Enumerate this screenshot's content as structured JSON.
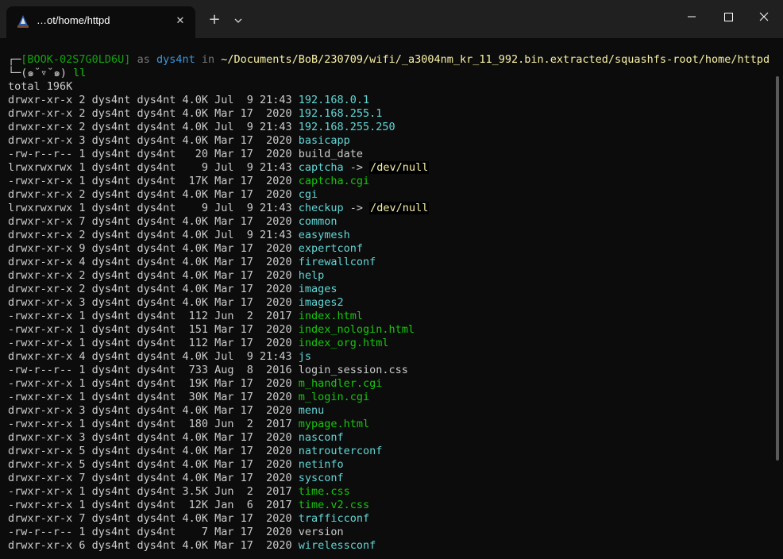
{
  "window": {
    "tab_title": "…ot/home/httpd",
    "close_tab_glyph": "✕",
    "new_tab_glyph": "+",
    "icons": [
      "terminal-app-icon",
      "close-icon",
      "plus-icon",
      "chevron-down-icon",
      "minimize-icon",
      "maximize-icon",
      "window-close-icon"
    ]
  },
  "prompt": {
    "line1_prefix": "┌─",
    "host": "[BOOK-02S7G0LD6U]",
    "as": " as ",
    "user": "dys4nt",
    "in": " in ",
    "path": "~/Documents/BoB/230709/wifi/_a3004nm_kr_11_992.bin.extracted/squashfs-root/home/httpd",
    "line2_prefix": "└─",
    "face": "(๑˘▿˘๑)",
    "command": " ll"
  },
  "total": "total 196K",
  "entries": [
    {
      "meta": "drwxr-xr-x 2 dys4nt dys4nt 4.0K Jul  9 21:43 ",
      "name": "192.168.0.1",
      "kind": "dir"
    },
    {
      "meta": "drwxr-xr-x 2 dys4nt dys4nt 4.0K Mar 17  2020 ",
      "name": "192.168.255.1",
      "kind": "dir"
    },
    {
      "meta": "drwxr-xr-x 2 dys4nt dys4nt 4.0K Jul  9 21:43 ",
      "name": "192.168.255.250",
      "kind": "dir"
    },
    {
      "meta": "drwxr-xr-x 3 dys4nt dys4nt 4.0K Mar 17  2020 ",
      "name": "basicapp",
      "kind": "dir"
    },
    {
      "meta": "-rw-r--r-- 1 dys4nt dys4nt   20 Mar 17  2020 ",
      "name": "build_date",
      "kind": "plain"
    },
    {
      "meta": "lrwxrwxrwx 1 dys4nt dys4nt    9 Jul  9 21:43 ",
      "name": "captcha",
      "kind": "link",
      "arrow": " -> ",
      "target": "/dev/null"
    },
    {
      "meta": "-rwxr-xr-x 1 dys4nt dys4nt  17K Mar 17  2020 ",
      "name": "captcha.cgi",
      "kind": "exe"
    },
    {
      "meta": "drwxr-xr-x 2 dys4nt dys4nt 4.0K Mar 17  2020 ",
      "name": "cgi",
      "kind": "dir"
    },
    {
      "meta": "lrwxrwxrwx 1 dys4nt dys4nt    9 Jul  9 21:43 ",
      "name": "checkup",
      "kind": "link",
      "arrow": " -> ",
      "target": "/dev/null"
    },
    {
      "meta": "drwxr-xr-x 7 dys4nt dys4nt 4.0K Mar 17  2020 ",
      "name": "common",
      "kind": "dir"
    },
    {
      "meta": "drwxr-xr-x 2 dys4nt dys4nt 4.0K Jul  9 21:43 ",
      "name": "easymesh",
      "kind": "dir"
    },
    {
      "meta": "drwxr-xr-x 9 dys4nt dys4nt 4.0K Mar 17  2020 ",
      "name": "expertconf",
      "kind": "dir"
    },
    {
      "meta": "drwxr-xr-x 4 dys4nt dys4nt 4.0K Mar 17  2020 ",
      "name": "firewallconf",
      "kind": "dir"
    },
    {
      "meta": "drwxr-xr-x 2 dys4nt dys4nt 4.0K Mar 17  2020 ",
      "name": "help",
      "kind": "dir"
    },
    {
      "meta": "drwxr-xr-x 2 dys4nt dys4nt 4.0K Mar 17  2020 ",
      "name": "images",
      "kind": "dir"
    },
    {
      "meta": "drwxr-xr-x 3 dys4nt dys4nt 4.0K Mar 17  2020 ",
      "name": "images2",
      "kind": "dir"
    },
    {
      "meta": "-rwxr-xr-x 1 dys4nt dys4nt  112 Jun  2  2017 ",
      "name": "index.html",
      "kind": "exe"
    },
    {
      "meta": "-rwxr-xr-x 1 dys4nt dys4nt  151 Mar 17  2020 ",
      "name": "index_nologin.html",
      "kind": "exe"
    },
    {
      "meta": "-rwxr-xr-x 1 dys4nt dys4nt  112 Mar 17  2020 ",
      "name": "index_org.html",
      "kind": "exe"
    },
    {
      "meta": "drwxr-xr-x 4 dys4nt dys4nt 4.0K Jul  9 21:43 ",
      "name": "js",
      "kind": "dir"
    },
    {
      "meta": "-rw-r--r-- 1 dys4nt dys4nt  733 Aug  8  2016 ",
      "name": "login_session.css",
      "kind": "plain"
    },
    {
      "meta": "-rwxr-xr-x 1 dys4nt dys4nt  19K Mar 17  2020 ",
      "name": "m_handler.cgi",
      "kind": "exe"
    },
    {
      "meta": "-rwxr-xr-x 1 dys4nt dys4nt  30K Mar 17  2020 ",
      "name": "m_login.cgi",
      "kind": "exe"
    },
    {
      "meta": "drwxr-xr-x 3 dys4nt dys4nt 4.0K Mar 17  2020 ",
      "name": "menu",
      "kind": "dir"
    },
    {
      "meta": "-rwxr-xr-x 1 dys4nt dys4nt  180 Jun  2  2017 ",
      "name": "mypage.html",
      "kind": "exe"
    },
    {
      "meta": "drwxr-xr-x 3 dys4nt dys4nt 4.0K Mar 17  2020 ",
      "name": "nasconf",
      "kind": "dir"
    },
    {
      "meta": "drwxr-xr-x 5 dys4nt dys4nt 4.0K Mar 17  2020 ",
      "name": "natrouterconf",
      "kind": "dir"
    },
    {
      "meta": "drwxr-xr-x 5 dys4nt dys4nt 4.0K Mar 17  2020 ",
      "name": "netinfo",
      "kind": "dir"
    },
    {
      "meta": "drwxr-xr-x 7 dys4nt dys4nt 4.0K Mar 17  2020 ",
      "name": "sysconf",
      "kind": "dir"
    },
    {
      "meta": "-rwxr-xr-x 1 dys4nt dys4nt 3.5K Jun  2  2017 ",
      "name": "time.css",
      "kind": "exe"
    },
    {
      "meta": "-rwxr-xr-x 1 dys4nt dys4nt  12K Jan  6  2017 ",
      "name": "time.v2.css",
      "kind": "exe"
    },
    {
      "meta": "drwxr-xr-x 7 dys4nt dys4nt 4.0K Mar 17  2020 ",
      "name": "trafficconf",
      "kind": "dir"
    },
    {
      "meta": "-rw-r--r-- 1 dys4nt dys4nt    7 Mar 17  2020 ",
      "name": "version",
      "kind": "plain"
    },
    {
      "meta": "drwxr-xr-x 6 dys4nt dys4nt 4.0K Mar 17  2020 ",
      "name": "wirelessconf",
      "kind": "dir"
    }
  ],
  "colors": {
    "background": "#0c0c0c",
    "titlebar": "#202020",
    "text": "#cccccc",
    "host": "#13a10e",
    "user": "#3a96dd",
    "path": "#f9f1a5",
    "directory": "#61d6d6",
    "executable": "#16c60c"
  }
}
